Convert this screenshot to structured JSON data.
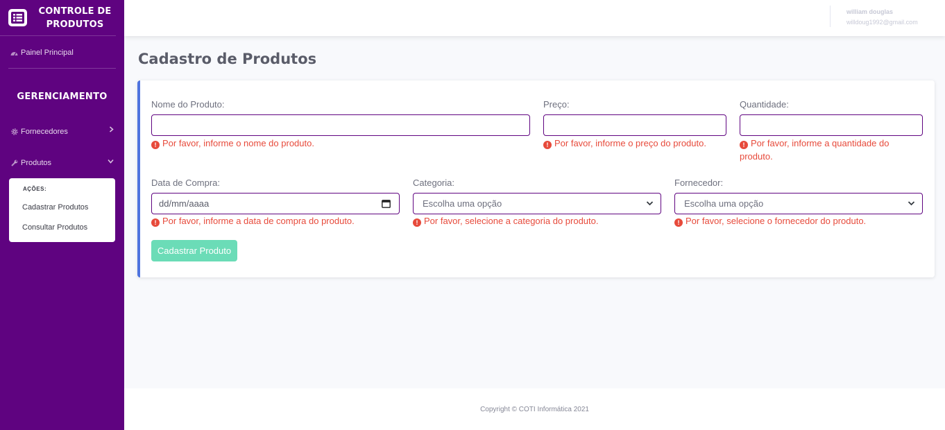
{
  "sidebar": {
    "brand_line1": "CONTROLE DE",
    "brand_line2": "PRODUTOS",
    "dashboard_label": "Painel Principal",
    "section_heading": "GERENCIAMENTO",
    "items": [
      {
        "label": "Fornecedores",
        "icon": "cog-icon",
        "chevron": "chevron-right-icon"
      },
      {
        "label": "Produtos",
        "icon": "wrench-icon",
        "chevron": "chevron-down-icon"
      }
    ],
    "submenu": {
      "heading": "AÇÕES:",
      "items": [
        "Cadastrar Produtos",
        "Consultar Produtos"
      ]
    }
  },
  "topbar": {
    "user_name": "william douglas",
    "user_email": "willdoug1992@gmail.com"
  },
  "main": {
    "page_title": "Cadastro de Produtos",
    "form": {
      "nome_label": "Nome do Produto:",
      "nome_value": "",
      "nome_error": "Por favor, informe o nome do produto.",
      "preco_label": "Preço:",
      "preco_value": "",
      "preco_error": "Por favor, informe o preço do produto.",
      "quantidade_label": "Quantidade:",
      "quantidade_value": "",
      "quantidade_error": "Por favor, informe a quantidade do produto.",
      "data_label": "Data de Compra:",
      "data_placeholder": "dd/mm/aaaa",
      "data_error": "Por favor, informe a data de compra do produto.",
      "categoria_label": "Categoria:",
      "categoria_selected": "Escolha uma opção",
      "categoria_error": "Por favor, selecione a categoria do produto.",
      "fornecedor_label": "Fornecedor:",
      "fornecedor_selected": "Escolha uma opção",
      "fornecedor_error": "Por favor, selecione o fornecedor do produto.",
      "submit_label": "Cadastrar Produto"
    }
  },
  "footer": {
    "copyright": "Copyright © COTI Informática 2021"
  },
  "colors": {
    "sidebar": "#5f0380",
    "accent": "#4e73df",
    "error": "#e74a3b",
    "button": "#6bdcb7"
  }
}
